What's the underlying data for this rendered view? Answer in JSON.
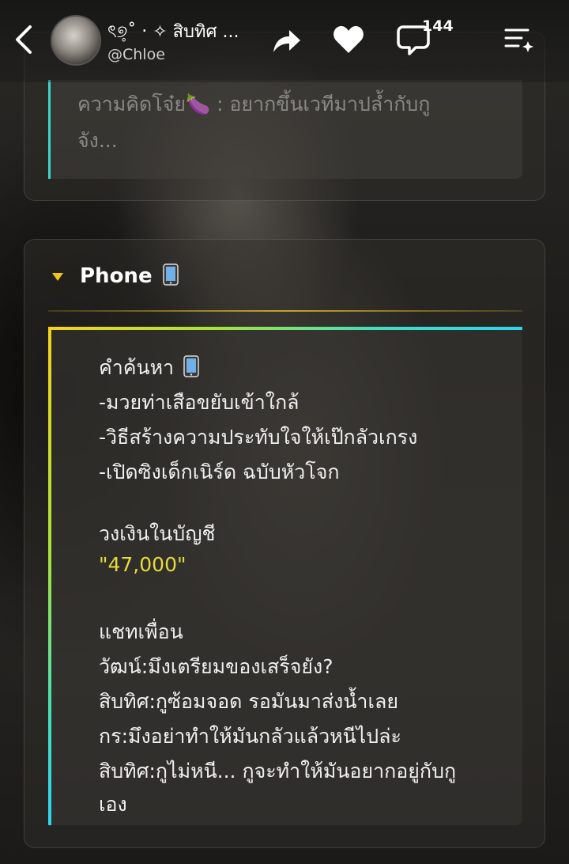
{
  "header": {
    "title": "ৎ୭̥˚ ‧ ✧ สิบทิศ ...",
    "handle": "@Chloe",
    "comment_count": "144"
  },
  "icons": {
    "back": "back-chevron-icon",
    "share": "share-arrow-icon",
    "like": "heart-icon",
    "comment": "comment-bubble-icon",
    "menu": "menu-list-icon"
  },
  "top_card": {
    "line1": "ความคิดโจ๋ย🍆 : อยากขึ้นเวทีมาปล้ำกับกู",
    "line2": "จัง..."
  },
  "phone_card": {
    "title": "Phone",
    "search_heading": "คำค้นหา",
    "search_items": [
      "-มวยท่าเสือขยับเข้าใกล้",
      "-วิธีสร้างความประทับใจให้เป๊กลัวเกรง",
      "-เปิดซิงเด็กเนิร์ด ฉบับหัวโจก"
    ],
    "balance_label": "วงเงินในบัญชี",
    "balance_value": "\"47,000\"",
    "chat_heading": "แชทเพื่อน",
    "chat_lines": [
      "วัฒน์:มึงเตรียมของเสร็จยัง?",
      "สิบทิศ:กูซ้อมจอด รอมันมาส่งน้ำเลย",
      "กร:มึงอย่าทำให้มันกลัวแล้วหนีไปล่ะ",
      "สิบทิศ:กูไม่หนี... กูจะทำให้มันอยากอยู่กับกู",
      "เอง"
    ]
  },
  "colors": {
    "accent_yellow": "#e9da3a",
    "accent_teal": "#3ad7c8",
    "caret_gold": "#f0c419"
  }
}
